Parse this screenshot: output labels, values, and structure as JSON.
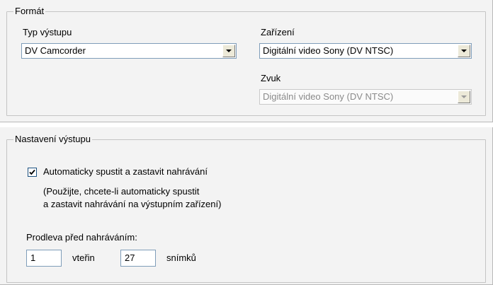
{
  "format_group": {
    "title": "Formát",
    "output_type": {
      "label": "Typ výstupu",
      "value": "DV Camcorder"
    },
    "device": {
      "label": "Zařízení",
      "value": "Digitální video Sony (DV NTSC)"
    },
    "audio": {
      "label": "Zvuk",
      "value": "Digitální video Sony (DV NTSC)",
      "disabled": true
    }
  },
  "output_settings_group": {
    "title": "Nastavení výstupu",
    "auto_record": {
      "label": "Automaticky spustit a zastavit nahrávání",
      "checked": true
    },
    "hint_line1": "(Použijte, chcete-li automaticky spustit",
    "hint_line2": "a zastavit nahrávání na výstupním zařízení)",
    "delay_label": "Prodleva před nahráváním:",
    "seconds_value": "1",
    "seconds_unit": "vteřin",
    "frames_value": "27",
    "frames_unit": "snímků"
  }
}
